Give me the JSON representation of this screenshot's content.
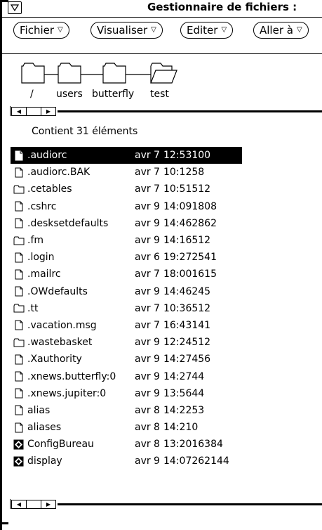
{
  "window": {
    "title": "Gestionnaire de fichiers :"
  },
  "menus": [
    {
      "label": "Fichier"
    },
    {
      "label": "Visualiser"
    },
    {
      "label": "Editer"
    },
    {
      "label": "Aller à"
    }
  ],
  "path": [
    "/",
    "users",
    "butterfly",
    "test"
  ],
  "status": {
    "count_text": "Contient 31 éléments"
  },
  "files": [
    {
      "type": "doc-black",
      "name": ".audiorc",
      "month": "avr",
      "day": "7",
      "info": "12:53100",
      "selected": true
    },
    {
      "type": "doc",
      "name": ".audiorc.BAK",
      "month": "avr",
      "day": "7",
      "info": "10:1258"
    },
    {
      "type": "folder",
      "name": ".cetables",
      "month": "avr",
      "day": "7",
      "info": "10:51512"
    },
    {
      "type": "doc",
      "name": ".cshrc",
      "month": "avr",
      "day": "9",
      "info": "14:091808"
    },
    {
      "type": "doc",
      "name": ".desksetdefaults",
      "month": "avr",
      "day": "9",
      "info": "14:462862"
    },
    {
      "type": "folder",
      "name": ".fm",
      "month": "avr",
      "day": "9",
      "info": "14:16512"
    },
    {
      "type": "doc",
      "name": ".login",
      "month": "avr",
      "day": "6",
      "info": "19:272541"
    },
    {
      "type": "doc",
      "name": ".mailrc",
      "month": "avr",
      "day": "7",
      "info": "18:001615"
    },
    {
      "type": "doc",
      "name": ".OWdefaults",
      "month": "avr",
      "day": "9",
      "info": "14:46245"
    },
    {
      "type": "folder",
      "name": ".tt",
      "month": "avr",
      "day": "7",
      "info": "10:36512"
    },
    {
      "type": "doc",
      "name": ".vacation.msg",
      "month": "avr",
      "day": "7",
      "info": "16:43141"
    },
    {
      "type": "folder",
      "name": ".wastebasket",
      "month": "avr",
      "day": "9",
      "info": "12:24512"
    },
    {
      "type": "doc",
      "name": ".Xauthority",
      "month": "avr",
      "day": "9",
      "info": "14:27456"
    },
    {
      "type": "doc",
      "name": ".xnews.butterfly:0",
      "month": "avr",
      "day": "9",
      "info": "14:2744"
    },
    {
      "type": "doc",
      "name": ".xnews.jupiter:0",
      "month": "avr",
      "day": "9",
      "info": "13:5644"
    },
    {
      "type": "doc",
      "name": "alias",
      "month": "avr",
      "day": "8",
      "info": "14:2253"
    },
    {
      "type": "doc",
      "name": "aliases",
      "month": "avr",
      "day": "8",
      "info": "14:210"
    },
    {
      "type": "app",
      "name": "ConfigBureau",
      "month": "avr",
      "day": "8",
      "info": "13:2016384"
    },
    {
      "type": "app",
      "name": "display",
      "month": "avr",
      "day": "9",
      "info": "14:07262144"
    }
  ]
}
